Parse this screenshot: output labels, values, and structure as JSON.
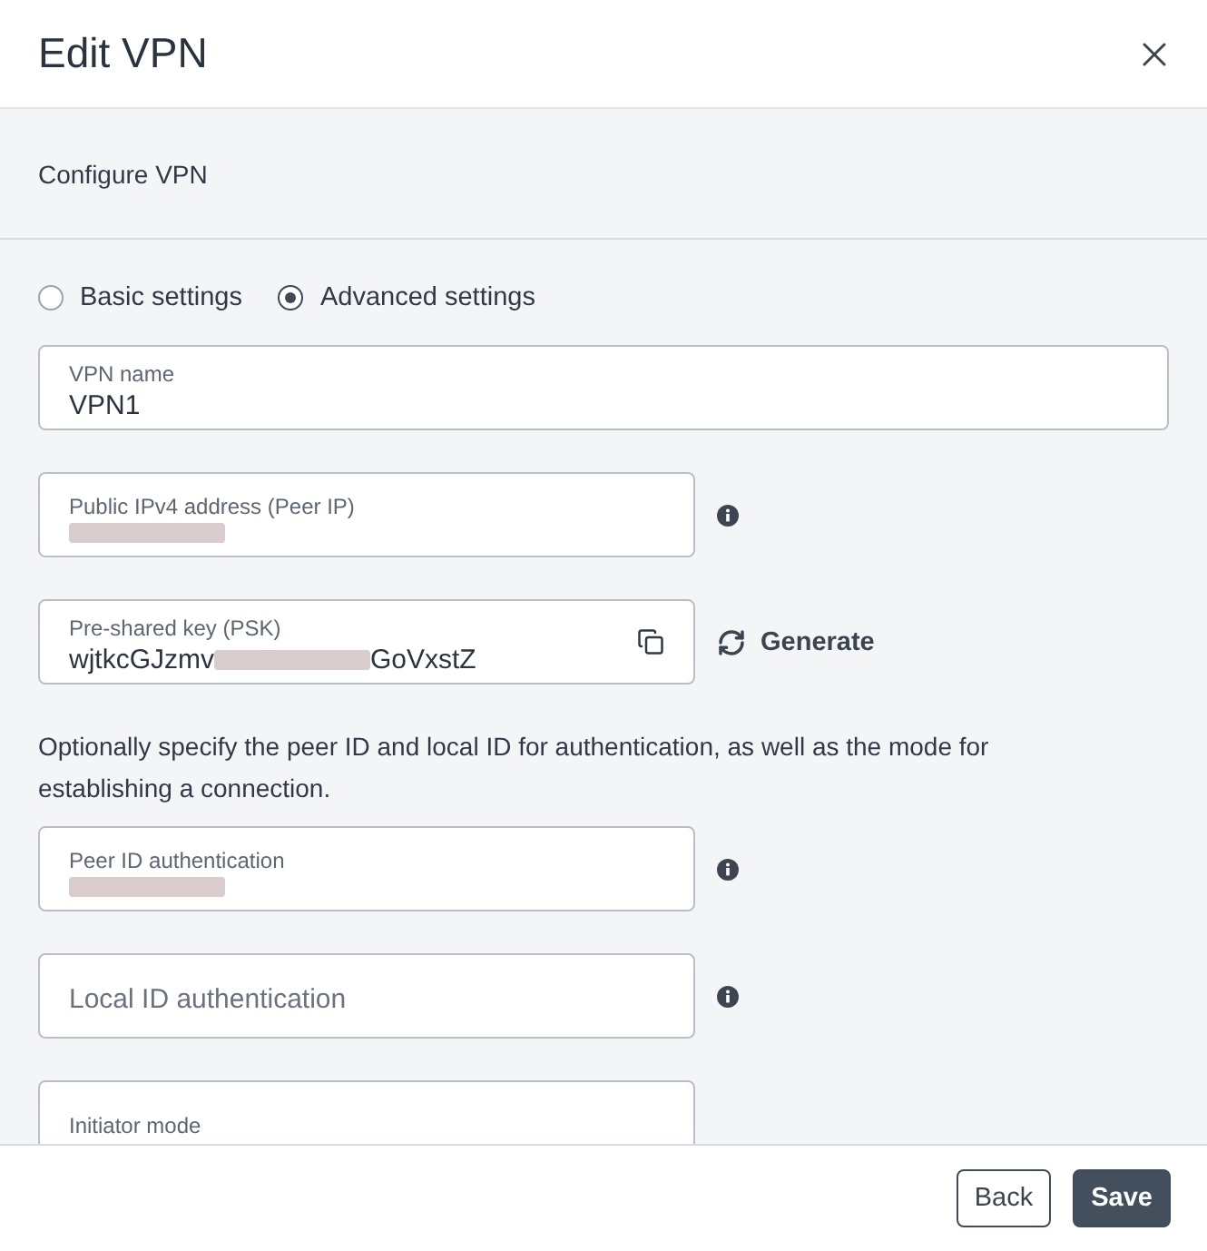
{
  "dialog": {
    "title": "Edit VPN"
  },
  "section": {
    "title": "Configure VPN"
  },
  "modes": [
    {
      "label": "Basic settings",
      "selected": false
    },
    {
      "label": "Advanced settings",
      "selected": true
    }
  ],
  "fields_top": [
    {
      "label": "VPN name",
      "value": "VPN1",
      "wide": true
    },
    {
      "label": "Public IPv4 address (Peer IP)",
      "redacted": true,
      "info": true
    },
    {
      "label": "Pre-shared key (PSK)",
      "value": "wjtkcGJzmv",
      "redacted": true,
      "value_end": "GoVxstZ",
      "copy": true,
      "action": "Generate"
    }
  ],
  "note": "Optionally specify the peer ID and local ID for authentication, as well as the mode for establishing a connection.",
  "fields_bottom": [
    {
      "label": "Peer ID authentication",
      "redacted": true,
      "info": true
    },
    {
      "placeholder": "Local ID authentication",
      "info": true
    },
    {
      "label": "Initiator mode"
    }
  ],
  "buttons": [
    {
      "label": "Back",
      "primary": false
    },
    {
      "label": "Save",
      "primary": true
    }
  ]
}
